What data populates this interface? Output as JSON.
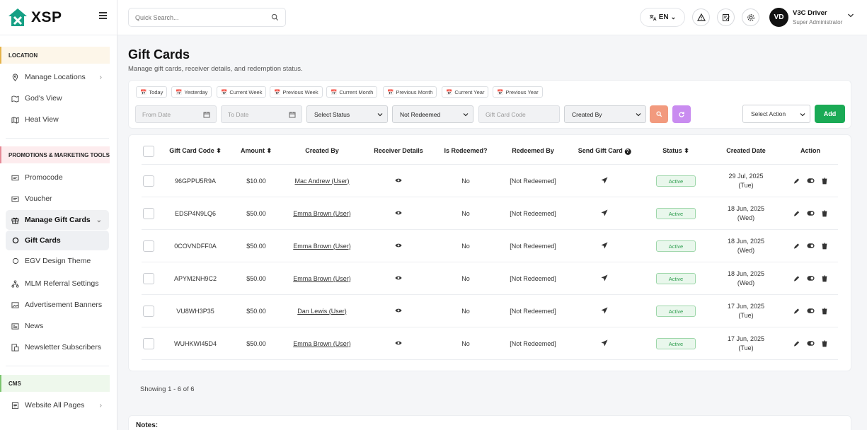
{
  "brand": {
    "name": "XSP"
  },
  "search": {
    "placeholder": "Quick Search..."
  },
  "language": {
    "code": "EN"
  },
  "user": {
    "initials": "VD",
    "name": "V3C Driver",
    "role": "Super Administrator"
  },
  "sidebar": {
    "sections": [
      {
        "title": "LOCATION",
        "items": [
          {
            "label": "Manage Locations",
            "icon": "location-pin-icon"
          },
          {
            "label": "God's View",
            "icon": "map-icon"
          },
          {
            "label": "Heat View",
            "icon": "heat-map-icon"
          }
        ]
      },
      {
        "title": "PROMOTIONS & MARKETING TOOLS",
        "items": [
          {
            "label": "Promocode",
            "icon": "ticket-icon"
          },
          {
            "label": "Voucher",
            "icon": "ticket-icon"
          },
          {
            "label": "Manage Gift Cards",
            "icon": "gift-icon"
          },
          {
            "label": "Gift Cards",
            "icon": "circle-icon"
          },
          {
            "label": "EGV Design Theme",
            "icon": "circle-icon"
          },
          {
            "label": "MLM Referral Settings",
            "icon": "network-icon"
          },
          {
            "label": "Advertisement Banners",
            "icon": "banner-icon"
          },
          {
            "label": "News",
            "icon": "news-icon"
          },
          {
            "label": "Newsletter Subscribers",
            "icon": "subscribers-icon"
          }
        ]
      },
      {
        "title": "CMS",
        "items": [
          {
            "label": "Website All Pages",
            "icon": "pages-icon"
          }
        ]
      }
    ]
  },
  "page": {
    "title": "Gift Cards",
    "subtitle": "Manage gift cards, receiver details, and redemption status."
  },
  "quick_filters": [
    "Today",
    "Yesterday",
    "Current Week",
    "Previous Week",
    "Current Month",
    "Previous Month",
    "Current Year",
    "Previous Year"
  ],
  "filters": {
    "from_date": "From Date",
    "to_date": "To Date",
    "status": "Select Status",
    "redeemed": "Not Redeemed",
    "code": "Gift Card Code",
    "created_by": "Created By",
    "action": "Select Action",
    "add": "Add"
  },
  "colors": {
    "search_btn": "#f29a7e",
    "reset_btn": "#c98cf0",
    "add_btn": "#1aaa55",
    "active_badge": "#2f9e4f"
  },
  "table": {
    "headers": [
      "Gift Card Code",
      "Amount",
      "Created By",
      "Receiver Details",
      "Is Redeemed?",
      "Redeemed By",
      "Send Gift Card",
      "Status",
      "Created Date",
      "Action"
    ],
    "rows": [
      {
        "code": "96GPPU5R9A",
        "amount": "$10.00",
        "created_by": "Mac Andrew (User)",
        "redeemed": "No",
        "redeemed_by": "[Not Redeemed]",
        "status": "Active",
        "date": "29 Jul, 2025",
        "day": "(Tue)"
      },
      {
        "code": "EDSP4N9LQ6",
        "amount": "$50.00",
        "created_by": "Emma Brown (User)",
        "redeemed": "No",
        "redeemed_by": "[Not Redeemed]",
        "status": "Active",
        "date": "18 Jun, 2025",
        "day": "(Wed)"
      },
      {
        "code": "0COVNDFF0A",
        "amount": "$50.00",
        "created_by": "Emma Brown (User)",
        "redeemed": "No",
        "redeemed_by": "[Not Redeemed]",
        "status": "Active",
        "date": "18 Jun, 2025",
        "day": "(Wed)"
      },
      {
        "code": "APYM2NH9C2",
        "amount": "$50.00",
        "created_by": "Emma Brown (User)",
        "redeemed": "No",
        "redeemed_by": "[Not Redeemed]",
        "status": "Active",
        "date": "18 Jun, 2025",
        "day": "(Wed)"
      },
      {
        "code": "VU8WH3P35",
        "amount": "$50.00",
        "created_by": "Dan Lewis (User)",
        "redeemed": "No",
        "redeemed_by": "[Not Redeemed]",
        "status": "Active",
        "date": "17 Jun, 2025",
        "day": "(Tue)"
      },
      {
        "code": "WUHKWI45D4",
        "amount": "$50.00",
        "created_by": "Emma Brown (User)",
        "redeemed": "No",
        "redeemed_by": "[Not Redeemed]",
        "status": "Active",
        "date": "17 Jun, 2025",
        "day": "(Tue)"
      }
    ]
  },
  "pagination": {
    "summary": "Showing 1 - 6 of 6"
  },
  "notes": {
    "title": "Notes:"
  }
}
